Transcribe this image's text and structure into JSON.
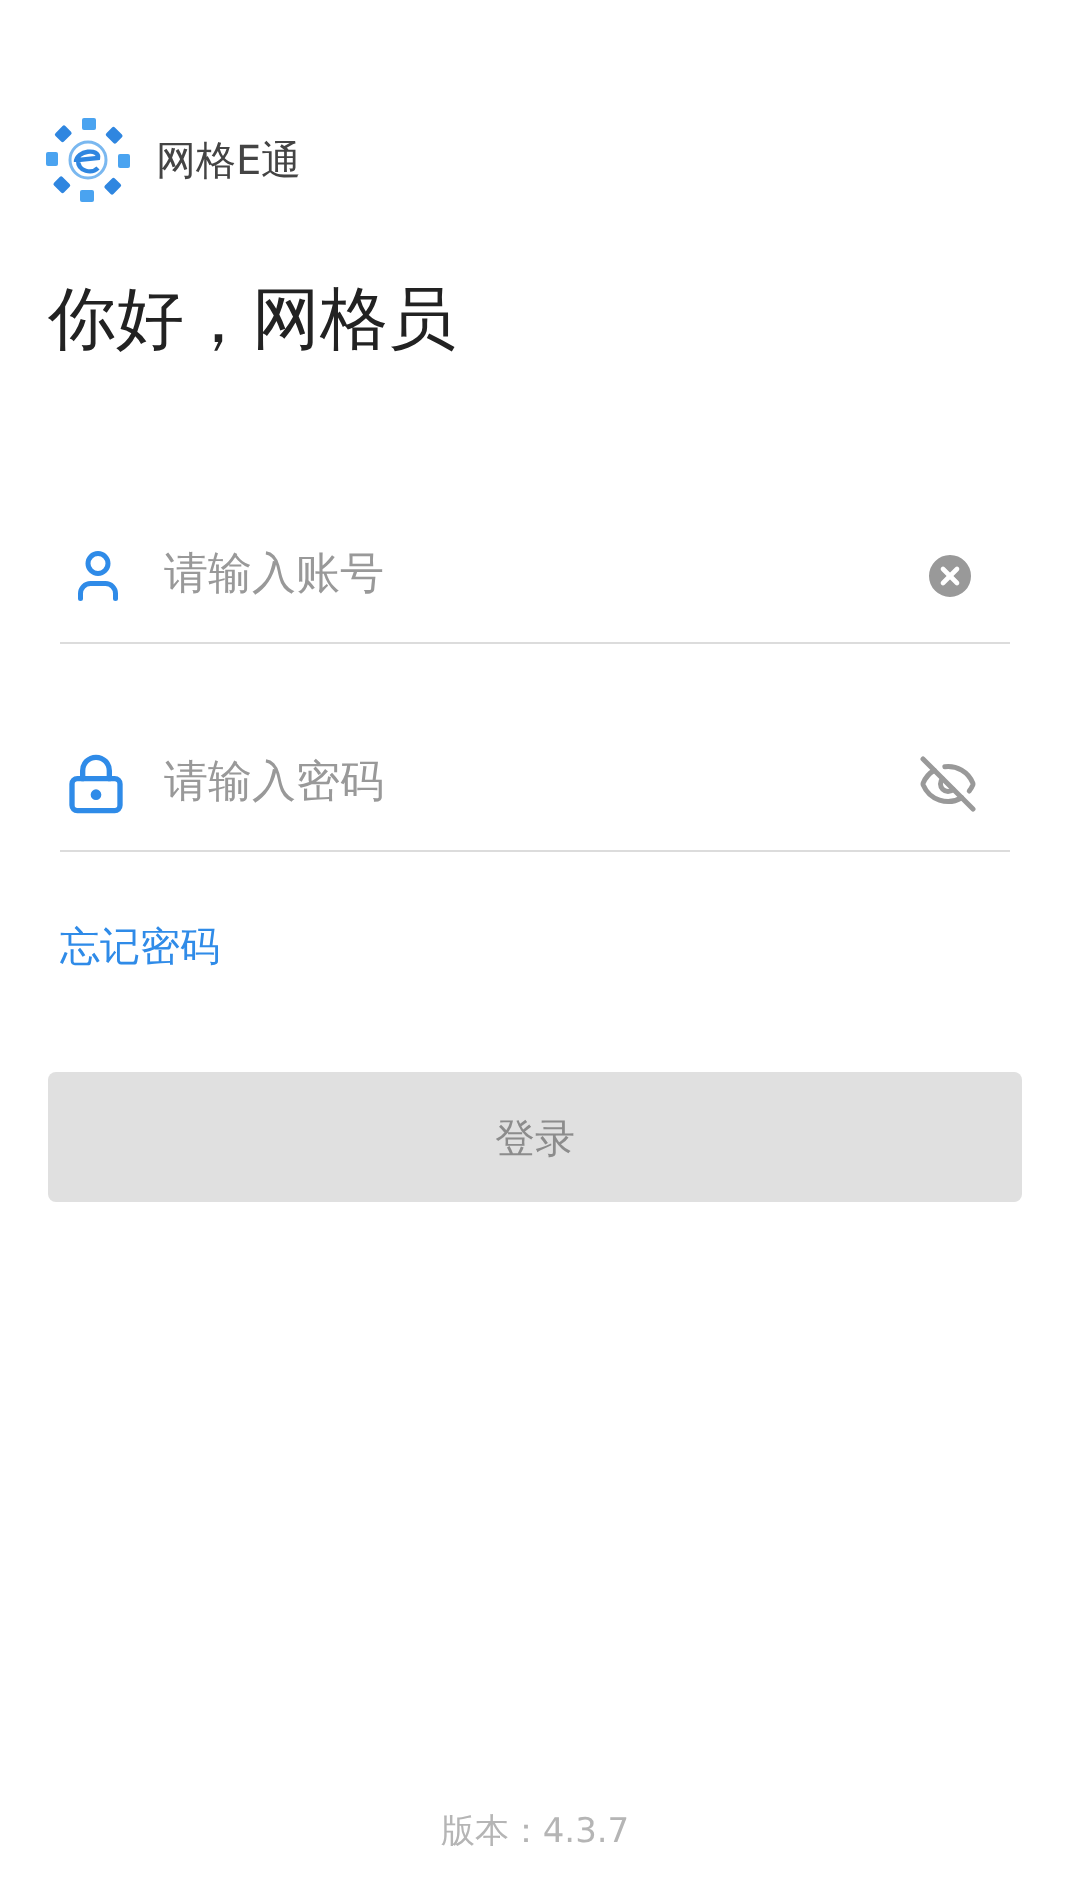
{
  "app": {
    "name": "网格E通"
  },
  "greeting": "你好，网格员",
  "username": {
    "placeholder": "请输入账号"
  },
  "password": {
    "placeholder": "请输入密码",
    "visible": false
  },
  "forgot_link": "忘记密码",
  "login_button": {
    "label": "登录",
    "disabled": true
  },
  "version": "版本：4.3.7"
}
